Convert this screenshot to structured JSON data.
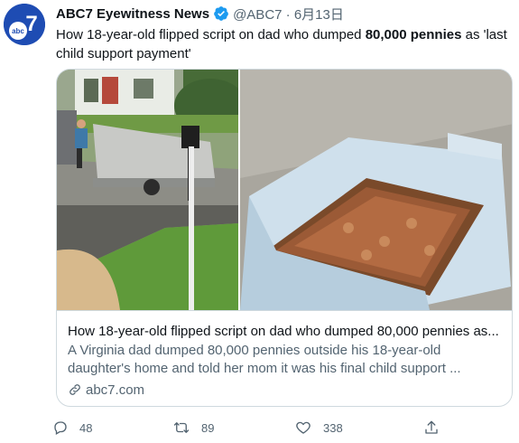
{
  "tweet": {
    "author_name": "ABC7 Eyewitness News",
    "handle_and_date": "@ABC7 · 6月13日",
    "avatar_text": "abc",
    "avatar_number": "7",
    "text_part1": "How 18-year-old flipped script on dad who dumped ",
    "text_bold": "80,000 pennies",
    "text_part2": " as 'last child support payment'"
  },
  "card": {
    "title": "How 18-year-old flipped script on dad who dumped 80,000 pennies as...",
    "description": "A Virginia dad dumped 80,000 pennies outside his 18-year-old daughter's home and told her mom it was his final child support ...",
    "link": "abc7.com"
  },
  "actions": {
    "reply_count": "48",
    "retweet_count": "89",
    "like_count": "338"
  },
  "icons": {
    "verified": "verified-badge-icon",
    "reply": "reply-icon",
    "retweet": "retweet-icon",
    "like": "heart-icon",
    "share": "share-icon",
    "link": "link-icon"
  },
  "colors": {
    "brand_blue": "#1e4cb3",
    "verified_blue": "#1d9bf0",
    "secondary_text": "#536471",
    "border": "#cfd9de"
  }
}
